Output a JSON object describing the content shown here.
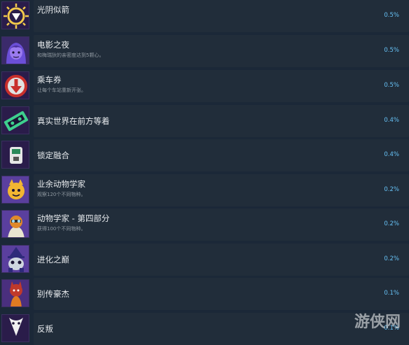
{
  "achievements": [
    {
      "title": "光阴似箭",
      "desc": "",
      "percent": "0.5%",
      "icon": "sun-eye-icon"
    },
    {
      "title": "电影之夜",
      "desc": "和梅瑞狄的亲密度达到5颗心。",
      "percent": "0.5%",
      "icon": "portrait-girl-icon"
    },
    {
      "title": "乘车券",
      "desc": "让每个车站重新开张。",
      "percent": "0.5%",
      "icon": "down-arrow-ticket-icon"
    },
    {
      "title": "真实世界在前方等着",
      "desc": "",
      "percent": "0.4%",
      "icon": "cassette-tape-icon"
    },
    {
      "title": "锁定融合",
      "desc": "",
      "percent": "0.4%",
      "icon": "device-lock-icon"
    },
    {
      "title": "业余动物学家",
      "desc": "观察120个不同物种。",
      "percent": "0.2%",
      "icon": "yellow-creature-icon"
    },
    {
      "title": "动物学家 - 第四部分",
      "desc": "获得100个不同物种。",
      "percent": "0.2%",
      "icon": "scientist-creature-icon"
    },
    {
      "title": "进化之巅",
      "desc": "",
      "percent": "0.2%",
      "icon": "wizard-creature-icon"
    },
    {
      "title": "别传豪杰",
      "desc": "",
      "percent": "0.1%",
      "icon": "red-hero-icon"
    },
    {
      "title": "反叛",
      "desc": "",
      "percent": "0.1%",
      "icon": "rebel-mask-icon"
    }
  ],
  "watermark": "游侠网"
}
